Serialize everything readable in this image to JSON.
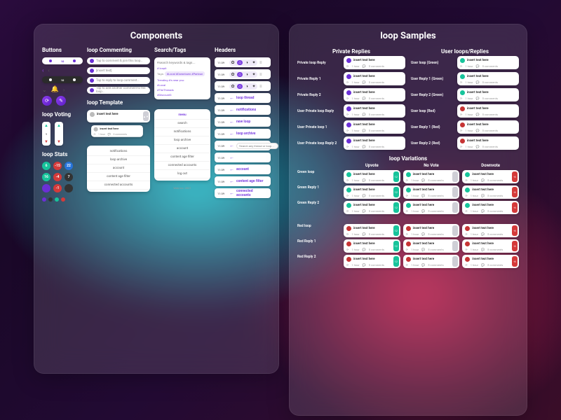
{
  "titles": {
    "components": "Components",
    "samples": "loop Samples"
  },
  "sections": {
    "buttons": "Buttons",
    "commenting": "loop Commenting",
    "template": "loop Template",
    "voting": "loop Voting",
    "stats": "loop Stats",
    "search": "Search/Tags",
    "headers": "Headers",
    "private_replies": "Private Replies",
    "user_loops": "User loops/Replies",
    "variations": "loop Variations"
  },
  "commenting": {
    "compose": "Tap to comment & join this loop…",
    "insert": "[insert text]",
    "reply": "Tap to reply to loop comment…",
    "add_another": "Tap to add another comment to the loop…"
  },
  "template": {
    "loop_text": "insert text here",
    "meta_time": "1 hour",
    "meta_comments": "5 comments"
  },
  "search": {
    "placeholder": "#search keywords & tags…",
    "hash": "# loopit",
    "tags_label": "Tags:",
    "tags_text": "#Local #Downtown #Parkrun",
    "trend": "Trending #'s near you:",
    "t1": "#Local",
    "t2": "#TheThreads",
    "t3": "#Discount3"
  },
  "menu": {
    "sub_items": [
      "notifications",
      "loop archive",
      "account",
      "content age filter",
      "connected accounts"
    ],
    "main": {
      "title": "menu",
      "items": [
        "search",
        "notifications",
        "loop archive",
        "account",
        "content age filter",
        "connected accounts",
        "log out"
      ]
    },
    "footer": "Web Inc. 2021"
  },
  "headers": {
    "time": "11:39",
    "list": [
      "loop thread",
      "notifications",
      "new loop",
      "loop archive",
      "",
      "",
      "account",
      "content age filter",
      "connected accounts"
    ],
    "search_ph": "Search any thread or loop…"
  },
  "stats": {
    "badges": [
      {
        "c": "#17c49b",
        "t": "6"
      },
      {
        "c": "#d43a3a",
        "t": "-15"
      },
      {
        "c": "#2673d9",
        "t": "22"
      },
      {
        "c": "#17c49b",
        "t": "16"
      },
      {
        "c": "#d43a3a",
        "t": "-4"
      },
      {
        "c": "#333",
        "t": "7"
      },
      {
        "c": "#6b2fd6",
        "t": ""
      },
      {
        "c": "#d43a3a",
        "t": "-1"
      },
      {
        "c": "#333",
        "t": ""
      }
    ],
    "dots": [
      "#6b2fd6",
      "#333",
      "#17c49b",
      "#d43a3a"
    ]
  },
  "private": [
    "Private loop Reply",
    "Private Reply 1",
    "Private Reply 2",
    "User Private loop Reply",
    "User Private loop 1",
    "User Private loop Reply 2"
  ],
  "user_loops": [
    "User loop (Green)",
    "User Reply 1 (Green)",
    "User Reply 2 (Green)",
    "User loop (Red)",
    "User Reply 1 (Red)",
    "User Reply 2 (Red)"
  ],
  "variation_cols": [
    "Upvote",
    "No Vote",
    "Downvote"
  ],
  "variation_rows": [
    "Green loop",
    "Green Reply 1",
    "Green Reply 2",
    "",
    "Red loop",
    "Red Reply 1",
    "Red Reply 2"
  ]
}
